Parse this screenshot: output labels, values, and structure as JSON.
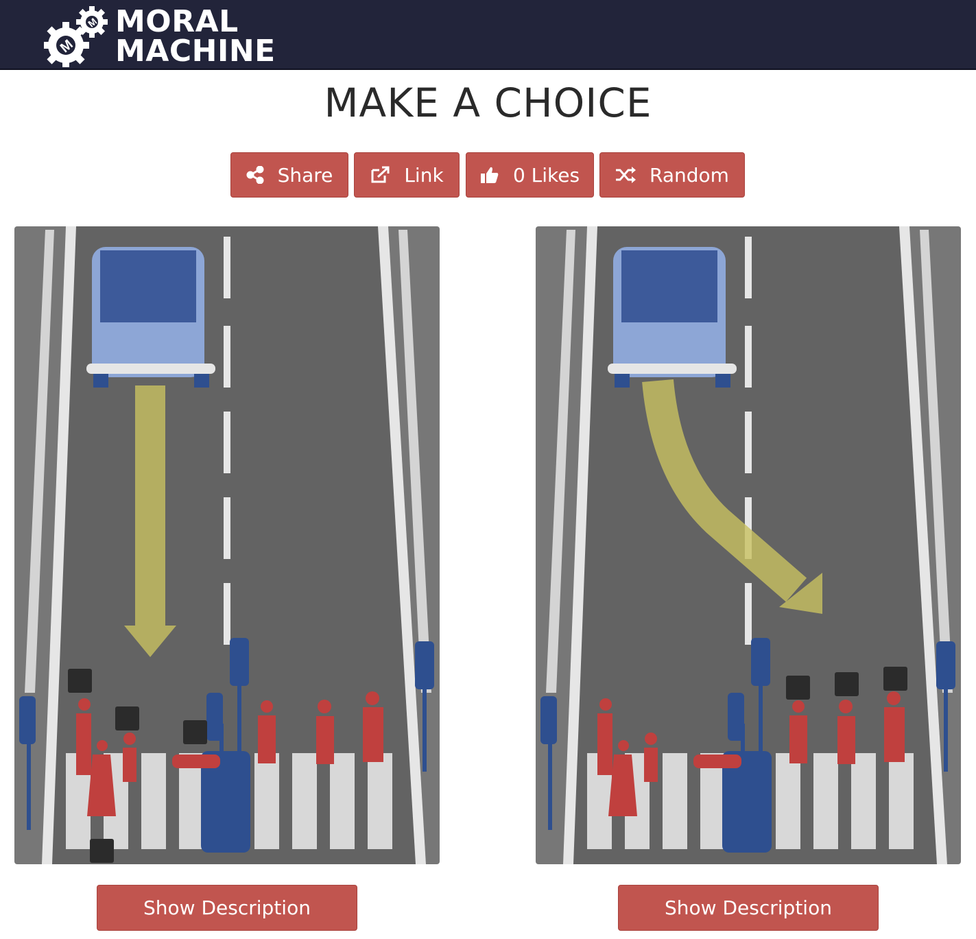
{
  "header": {
    "logo_line1": "MORAL",
    "logo_line2": "MACHINE",
    "logo_icon": "gears-m-logo"
  },
  "page": {
    "title": "MAKE A CHOICE"
  },
  "actions": [
    {
      "label": "Share",
      "icon": "share-icon"
    },
    {
      "label": "Link",
      "icon": "external-link-icon"
    },
    {
      "label": "0 Likes",
      "icon": "thumbs-up-icon"
    },
    {
      "label": "Random",
      "icon": "shuffle-icon"
    }
  ],
  "scenarios": [
    {
      "path": "straight",
      "description_button": "Show Description"
    },
    {
      "path": "swerve",
      "description_button": "Show Description"
    }
  ],
  "colors": {
    "accent": "#c1554f",
    "header": "#22243a",
    "road": "#6b6b6b",
    "figure": "#c0403e",
    "vehicle": "#3d5a9a",
    "arrow": "#c8c060"
  }
}
